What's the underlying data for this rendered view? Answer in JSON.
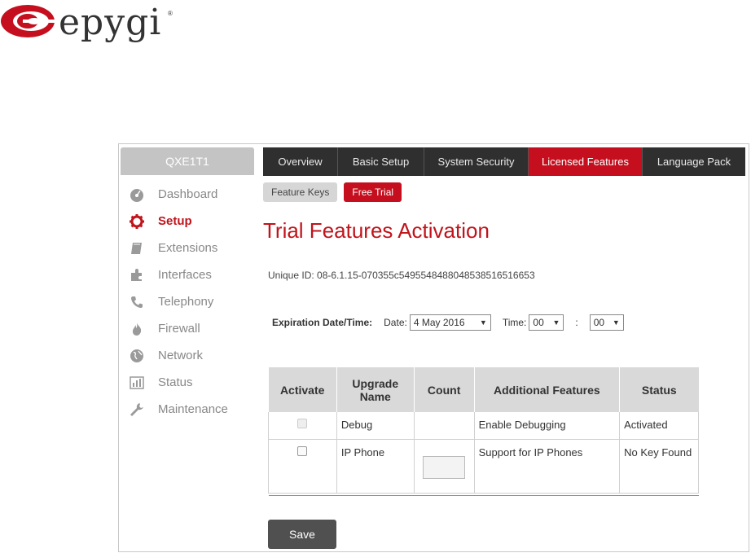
{
  "brand": {
    "name": "epygi",
    "registered": "®",
    "accent": "#c50f1e"
  },
  "device": {
    "name": "QXE1T1"
  },
  "sidebar": {
    "items": [
      {
        "label": "Dashboard",
        "icon": "dashboard-icon",
        "active": false
      },
      {
        "label": "Setup",
        "icon": "gear-icon",
        "active": true
      },
      {
        "label": "Extensions",
        "icon": "book-icon",
        "active": false
      },
      {
        "label": "Interfaces",
        "icon": "puzzle-icon",
        "active": false
      },
      {
        "label": "Telephony",
        "icon": "phone-icon",
        "active": false
      },
      {
        "label": "Firewall",
        "icon": "flame-icon",
        "active": false
      },
      {
        "label": "Network",
        "icon": "globe-icon",
        "active": false
      },
      {
        "label": "Status",
        "icon": "bar-chart-icon",
        "active": false
      },
      {
        "label": "Maintenance",
        "icon": "wrench-icon",
        "active": false
      }
    ]
  },
  "topnav": {
    "tabs": [
      {
        "label": "Overview",
        "active": false
      },
      {
        "label": "Basic Setup",
        "active": false
      },
      {
        "label": "System Security",
        "active": false
      },
      {
        "label": "Licensed Features",
        "active": true
      },
      {
        "label": "Language Pack",
        "active": false
      }
    ]
  },
  "subtabs": [
    {
      "label": "Feature Keys",
      "active": false
    },
    {
      "label": "Free Trial",
      "active": true
    }
  ],
  "page": {
    "title": "Trial Features Activation",
    "unique_id": "Unique ID: 08-6.1.15-070355c5495548488048538516516653"
  },
  "expiration": {
    "label": "Expiration Date/Time:",
    "date_label": "Date:",
    "date_value": "4 May 2016",
    "time_label": "Time:",
    "hour_value": "00",
    "separator": ":",
    "minute_value": "00"
  },
  "table": {
    "headers": [
      "Activate",
      "Upgrade Name",
      "Count",
      "Additional Features",
      "Status"
    ],
    "rows": [
      {
        "activate_enabled": false,
        "name": "Debug",
        "count": "",
        "additional": "Enable Debugging",
        "status": "Activated"
      },
      {
        "activate_enabled": true,
        "name": "IP Phone",
        "count": "",
        "additional": "Support for IP Phones",
        "status": "No Key Found"
      }
    ]
  },
  "actions": {
    "save_label": "Save"
  }
}
